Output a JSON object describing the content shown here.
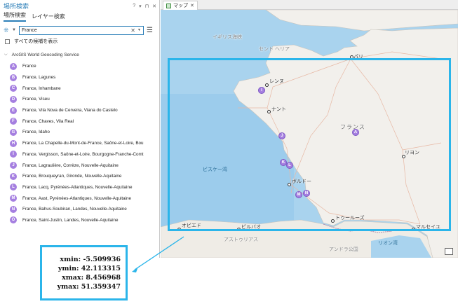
{
  "pane": {
    "title": "場所検索",
    "controls": [
      "?",
      "▾",
      "⊓",
      "✕"
    ],
    "tabs": [
      {
        "label": "場所検索",
        "active": true
      },
      {
        "label": "レイヤー検索",
        "active": false
      }
    ],
    "search": {
      "value": "France",
      "clear": "✕",
      "arrow": "▾"
    },
    "menu_icon": "☰",
    "show_all_candidates": "すべての候補を表示",
    "service": "ArcGIS World Geocoding Service",
    "results": [
      {
        "letter": "A",
        "label": "France"
      },
      {
        "letter": "B",
        "label": "France, Lagunes"
      },
      {
        "letter": "C",
        "label": "France, Inhambane"
      },
      {
        "letter": "D",
        "label": "France, Viseu"
      },
      {
        "letter": "E",
        "label": "France, Vila Nova de Cerveira, Viana do Castelo"
      },
      {
        "letter": "F",
        "label": "France, Chaves, Vila Real"
      },
      {
        "letter": "G",
        "label": "France, Idaho"
      },
      {
        "letter": "H",
        "label": "France, La Chapelle-du-Mont-de-France, Saône-et-Loire, Bou"
      },
      {
        "letter": "I",
        "label": "France, Vergisson, Saône-et-Loire, Bourgogne-Franche-Comt"
      },
      {
        "letter": "J",
        "label": "France, Lagraulière, Corrèze, Nouvelle-Aquitaine"
      },
      {
        "letter": "K",
        "label": "France, Brouqueyran, Gironde, Nouvelle-Aquitaine"
      },
      {
        "letter": "L",
        "label": "France, Lacq, Pyrénées-Atlantiques, Nouvelle-Aquitaine"
      },
      {
        "letter": "M",
        "label": "France, Aast, Pyrénées-Atlantiques, Nouvelle-Aquitaine"
      },
      {
        "letter": "N",
        "label": "France, Bahus-Soubiran, Landes, Nouvelle-Aquitaine"
      },
      {
        "letter": "O",
        "label": "France, Saint-Justin, Landes, Nouvelle-Aquitaine"
      }
    ]
  },
  "map": {
    "tab_label": "マップ",
    "tab_close": "✕",
    "labels": {
      "english_channel": "イギリス海峡",
      "st_helier": "セント ヘリア",
      "paris": "パリ",
      "rennes": "レンヌ",
      "nantes": "ナント",
      "france": "フランス",
      "lyon": "リヨン",
      "biscay": "ビスケー湾",
      "bordeaux": "ボルドー",
      "toulouse": "トゥールーズ",
      "marseille": "マルセイユ",
      "oviedo": "オビエド",
      "bilbao": "ビルバオ",
      "asturias": "アストゥリアス",
      "gulf_of_lion": "リオン湾",
      "andorra": "アンドラ公国"
    },
    "markers": [
      "A",
      "I",
      "J",
      "K",
      "L",
      "M",
      "N"
    ],
    "colors": {
      "marker": "#a57fe0",
      "extent": "#2bb5ea",
      "sea": "#a9d3ee",
      "land": "#f2f0ec"
    }
  },
  "extent": {
    "xmin": "xmin: -5.509936",
    "ymin": "ymin: 42.113315",
    "xmax": "xmax: 8.456968",
    "ymax": "ymax: 51.359347"
  }
}
